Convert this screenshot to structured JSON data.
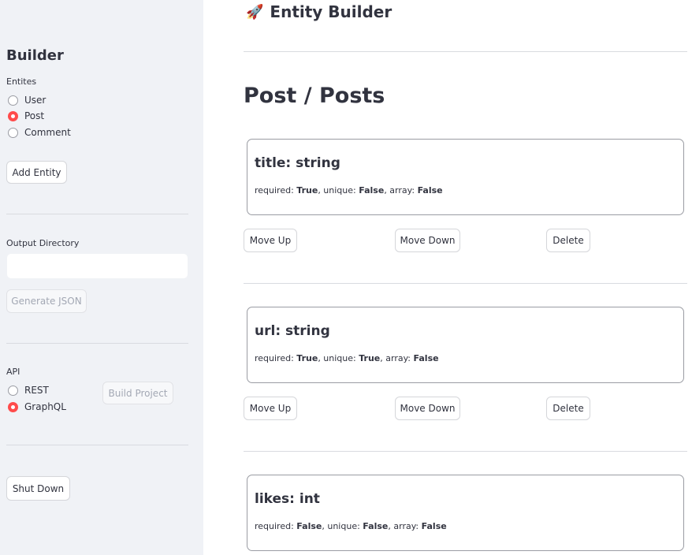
{
  "sidebar": {
    "title": "Builder",
    "entities_label": "Entites",
    "entities": [
      {
        "label": "User",
        "selected": false
      },
      {
        "label": "Post",
        "selected": true
      },
      {
        "label": "Comment",
        "selected": false
      }
    ],
    "add_entity_label": "Add Entity",
    "output_dir_label": "Output Directory",
    "output_dir_value": "",
    "generate_json_label": "Generate JSON",
    "api_label": "API",
    "api_options": [
      {
        "label": "REST",
        "selected": false
      },
      {
        "label": "GraphQL",
        "selected": true
      }
    ],
    "build_project_label": "Build Project",
    "shut_down_label": "Shut Down"
  },
  "main": {
    "app_title": "Entity Builder",
    "rocket_glyph": "🚀",
    "entity_heading": "Post / Posts",
    "fields": [
      {
        "title": "title: string",
        "required": "True",
        "unique": "False",
        "array": "False"
      },
      {
        "title": "url: string",
        "required": "True",
        "unique": "True",
        "array": "False"
      },
      {
        "title": "likes: int",
        "required": "False",
        "unique": "False",
        "array": "False"
      }
    ],
    "meta_labels": {
      "required": "required: ",
      "unique": ", unique: ",
      "array": ", array: "
    },
    "move_up_label": "Move Up",
    "move_down_label": "Move Down",
    "delete_label": "Delete"
  },
  "colors": {
    "accent": "#ff4b4b",
    "sidebar_bg": "#f0f2f6",
    "text": "#31333f"
  }
}
